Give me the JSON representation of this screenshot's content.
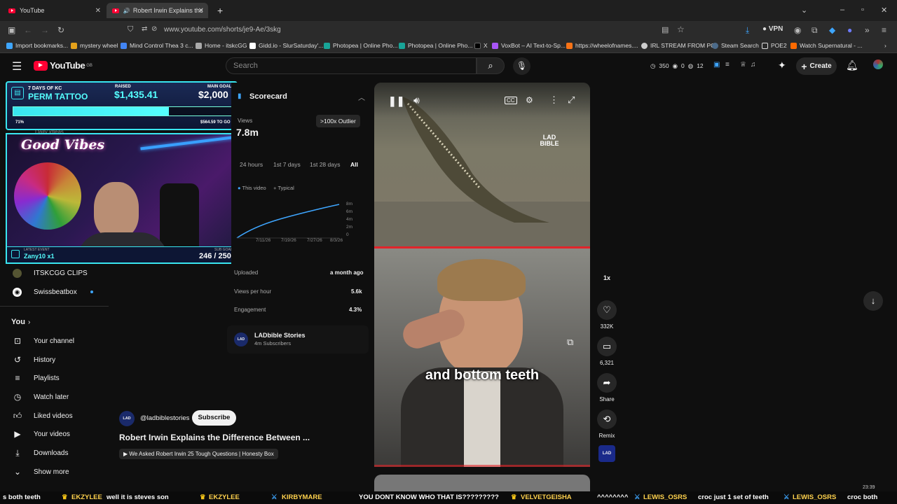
{
  "browser": {
    "tabs": [
      {
        "label": "YouTube"
      },
      {
        "label": "Robert Irwin Explains the D"
      }
    ],
    "url": "www.youtube.com/shorts/je9-Ae/3skg",
    "vpn_label": "VPN",
    "bookmarks": [
      {
        "label": "Import bookmarks...",
        "color": "#3ea6ff"
      },
      {
        "label": "mystery wheel",
        "color": "#e4a11b"
      },
      {
        "label": "Mind Control Thea 3 c...",
        "color": "#4285f4"
      },
      {
        "label": "Home - itskcGG",
        "color": "#aaaaaa"
      },
      {
        "label": "Gidd.io - SlurSaturday'...",
        "color": "#ffffff"
      },
      {
        "label": "Photopea | Online Pho...",
        "color": "#18a497"
      },
      {
        "label": "Photopea | Online Pho...",
        "color": "#18a497"
      },
      {
        "label": "X",
        "color": "#000000"
      },
      {
        "label": "VoxBot – AI Text-to-Sp...",
        "color": "#a855f7"
      },
      {
        "label": "https://wheelofnames....",
        "color": "#f97316"
      },
      {
        "label": "IRL STREAM FROM PC",
        "color": "#cccccc"
      },
      {
        "label": "Steam Search",
        "color": "#1b2838"
      },
      {
        "label": "POE2",
        "color": "#e0c050"
      },
      {
        "label": "Watch Supernatural - ...",
        "color": "#ff6a00"
      }
    ]
  },
  "yt": {
    "logo": "YouTube",
    "region": "GB",
    "search_placeholder": "Search",
    "counters": [
      "350",
      "0",
      "12"
    ],
    "create_label": "Create"
  },
  "overlay": {
    "goal_line1": "7 DAYS OF KC",
    "goal_line2": "PERM TATTOO",
    "raised_label": "RAISED",
    "raised": "$1,435.41",
    "main_goal_label": "MAIN GOAL",
    "main_goal": "$2,000",
    "percent": "71%",
    "to_go": "$564.59 TO GO",
    "progress_fraction": 0.71,
    "cam_text": "Good Vibes",
    "latest_event_label": "LATEST EVENT",
    "latest_event": "Zany10 x1",
    "sub_goal_label": "SUB GOAL",
    "sub_goal": "246 / 250",
    "peek_text": "Daily idleas"
  },
  "sidebar": {
    "subs": [
      {
        "label": "ITSKCGG CLIPS"
      },
      {
        "label": "Swissbeatbox"
      }
    ],
    "you_header": "You",
    "you_items": [
      {
        "label": "Your channel",
        "icon": "user-icon"
      },
      {
        "label": "History",
        "icon": "history-icon"
      },
      {
        "label": "Playlists",
        "icon": "playlist-icon"
      },
      {
        "label": "Watch later",
        "icon": "clock-icon"
      },
      {
        "label": "Liked videos",
        "icon": "thumb-up-icon"
      },
      {
        "label": "Your videos",
        "icon": "video-icon"
      },
      {
        "label": "Downloads",
        "icon": "download-icon"
      },
      {
        "label": "Show more",
        "icon": "chevron-down-icon"
      }
    ]
  },
  "stats": {
    "title": "Scorecard",
    "views_label": "Views",
    "views": "7.8m",
    "outlier": ">100x Outlier",
    "ranges": [
      "24 hours",
      "1st 7 days",
      "1st 28 days",
      "All"
    ],
    "legend": [
      "This video",
      "Typical"
    ],
    "y_ticks": [
      "8m",
      "6m",
      "4m",
      "2m",
      "0"
    ],
    "x_ticks": [
      "7/11/26",
      "7/19/26",
      "7/27/26",
      "8/3/26"
    ],
    "uploaded_label": "Uploaded",
    "uploaded": "a month ago",
    "vph_label": "Views per hour",
    "vph": "5.6k",
    "eng_label": "Engagement",
    "eng": "4.3%",
    "channel": "LADbible Stories",
    "channel_subs": "4m Subscribers"
  },
  "short": {
    "handle": "@ladbiblestories",
    "subscribe": "Subscribe",
    "title": "Robert Irwin Explains the Difference Between ...",
    "related": "We Asked Robert Irwin 25 Tough Questions | Honesty Box",
    "caption": "and bottom teeth",
    "watermark": "LAD BIBLE",
    "speed": "1x",
    "likes": "332K",
    "comments": "6,321",
    "share": "Share",
    "remix": "Remix"
  },
  "ticker": [
    {
      "user": "",
      "msg": "s both teeth"
    },
    {
      "user": "EKZYLEE",
      "msg": "well it is steves son"
    },
    {
      "user": "EKZYLEE",
      "msg": ""
    },
    {
      "user": "KIRBYMARE",
      "msg": "YOU DONT KNOW WHO THAT IS?????????"
    },
    {
      "user": "VELVETGEISHA",
      "msg": "^^^^^^^^"
    },
    {
      "user": "LEWIS_OSRS",
      "msg": "croc just 1 set of teeth"
    },
    {
      "user": "LEWIS_OSRS",
      "msg": "croc both"
    }
  ],
  "clock": "23:39"
}
